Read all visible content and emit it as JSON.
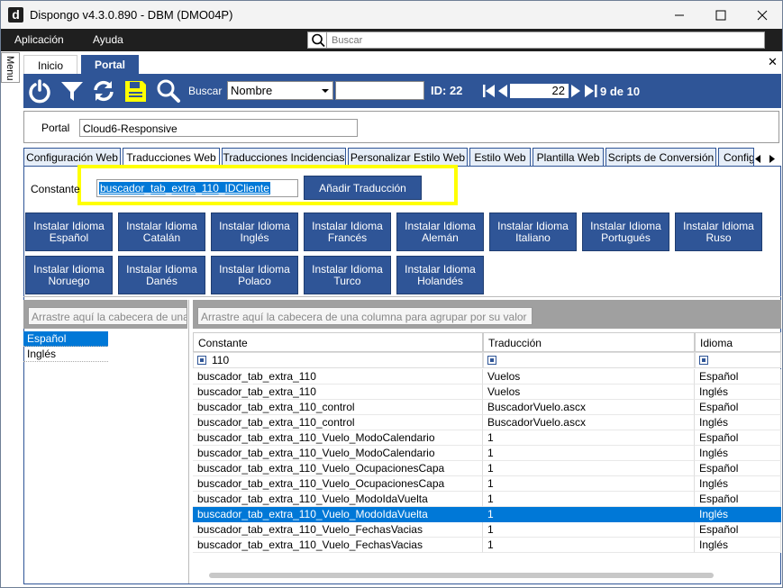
{
  "window": {
    "title": "Dispongo v4.3.0.890 - DBM (DMO04P)",
    "app_icon_letter": "d"
  },
  "menubar": {
    "items": [
      "Aplicación",
      "Ayuda"
    ],
    "search_placeholder": "Buscar"
  },
  "sidemenu": {
    "label": "Menu"
  },
  "top_tabs": {
    "inicio": "Inicio",
    "portal": "Portal"
  },
  "toolbar": {
    "search_label": "Buscar",
    "search_field": "Nombre",
    "search_value": "",
    "id_label": "ID: 22",
    "page_current": "22",
    "page_of": "9 de 10"
  },
  "portal": {
    "label": "Portal",
    "value": "Cloud6-Responsive"
  },
  "sub_tabs": [
    "Configuración Web",
    "Traducciones Web",
    "Traducciones Incidencias",
    "Personalizar Estilo Web",
    "Estilo Web",
    "Plantilla Web",
    "Scripts de Conversión",
    "Config"
  ],
  "constante": {
    "label": "Constante",
    "value": "buscador_tab_extra_110_IDCliente",
    "add_button": "Añadir Traducción"
  },
  "install_buttons": [
    [
      "Instalar Idioma",
      "Español"
    ],
    [
      "Instalar Idioma",
      "Catalán"
    ],
    [
      "Instalar Idioma",
      "Inglés"
    ],
    [
      "Instalar Idioma",
      "Francés"
    ],
    [
      "Instalar Idioma",
      "Alemán"
    ],
    [
      "Instalar Idioma",
      "Italiano"
    ],
    [
      "Instalar Idioma",
      "Portugués"
    ],
    [
      "Instalar Idioma",
      "Ruso"
    ],
    [
      "Instalar Idioma",
      "Noruego"
    ],
    [
      "Instalar Idioma",
      "Danés"
    ],
    [
      "Instalar Idioma",
      "Polaco"
    ],
    [
      "Instalar Idioma",
      "Turco"
    ],
    [
      "Instalar Idioma",
      "Holandés"
    ]
  ],
  "left_panel": {
    "group_hint": "Arrastre aquí la cabecera de una",
    "languages": [
      "Español",
      "Inglés"
    ]
  },
  "grid": {
    "group_hint": "Arrastre aquí la cabecera de una columna para agrupar por su valor",
    "headers": [
      "Constante",
      "Traducción",
      "Idioma"
    ],
    "filter": [
      "110",
      "",
      ""
    ],
    "rows": [
      [
        "buscador_tab_extra_110",
        "Vuelos",
        "Español"
      ],
      [
        "buscador_tab_extra_110",
        "Vuelos",
        "Inglés"
      ],
      [
        "buscador_tab_extra_110_control",
        "BuscadorVuelo.ascx",
        "Español"
      ],
      [
        "buscador_tab_extra_110_control",
        "BuscadorVuelo.ascx",
        "Inglés"
      ],
      [
        "buscador_tab_extra_110_Vuelo_ModoCalendario",
        "1",
        "Español"
      ],
      [
        "buscador_tab_extra_110_Vuelo_ModoCalendario",
        "1",
        "Inglés"
      ],
      [
        "buscador_tab_extra_110_Vuelo_OcupacionesCapa",
        "1",
        "Español"
      ],
      [
        "buscador_tab_extra_110_Vuelo_OcupacionesCapa",
        "1",
        "Inglés"
      ],
      [
        "buscador_tab_extra_110_Vuelo_ModoIdaVuelta",
        "1",
        "Español"
      ],
      [
        "buscador_tab_extra_110_Vuelo_ModoIdaVuelta",
        "1",
        "Inglés"
      ],
      [
        "buscador_tab_extra_110_Vuelo_FechasVacias",
        "1",
        "Español"
      ],
      [
        "buscador_tab_extra_110_Vuelo_FechasVacias",
        "1",
        "Inglés"
      ]
    ],
    "selected_row": 9
  },
  "colors": {
    "brand": "#2f5597",
    "selection": "#0078d7",
    "highlight": "#ffff00"
  }
}
